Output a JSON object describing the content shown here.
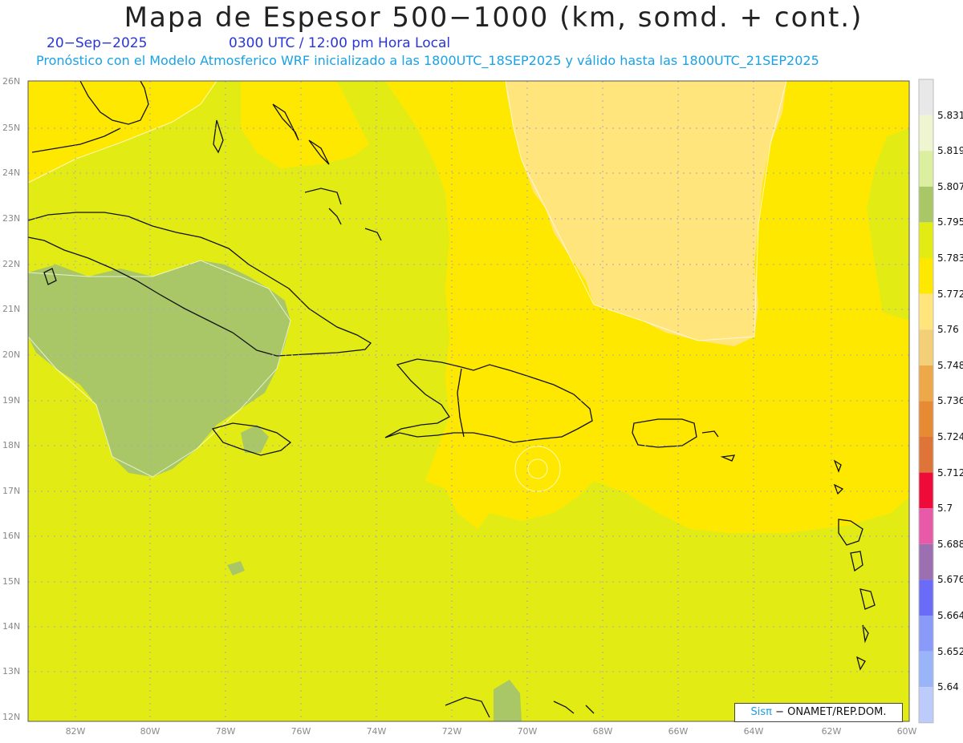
{
  "header": {
    "title": "Mapa de Espesor 500−1000 (km, somd. + cont.)",
    "date": "20−Sep−2025",
    "time": "0300 UTC / 12:00 pm Hora Local",
    "forecast": "Pronóstico con el Modelo Atmosferico WRF inicializado a las 1800UTC_18SEP2025 y válido hasta las  1800UTC_21SEP2025"
  },
  "map": {
    "lat_labels": [
      "26N",
      "25N",
      "24N",
      "23N",
      "22N",
      "21N",
      "20N",
      "19N",
      "18N",
      "17N",
      "16N",
      "15N",
      "14N",
      "13N",
      "12N"
    ],
    "lon_labels": [
      "82W",
      "80W",
      "78W",
      "76W",
      "74W",
      "72W",
      "70W",
      "68W",
      "66W",
      "64W",
      "62W",
      "60W"
    ],
    "colors": {
      "thickness_5783": "#e2ec14",
      "thickness_5795": "#a9c766",
      "thickness_5772": "#ffe800",
      "thickness_5760": "#ffe57c",
      "coast": "#111111",
      "grid": "#a6a6c8"
    }
  },
  "colorbar": {
    "labels": [
      "5.831",
      "5.819",
      "5.807",
      "5.795",
      "5.783",
      "5.772",
      "5.76",
      "5.748",
      "5.736",
      "5.724",
      "5.712",
      "5.7",
      "5.688",
      "5.676",
      "5.664",
      "5.652",
      "5.64"
    ],
    "colors": [
      "#e8e8e8",
      "#eef5d0",
      "#dceea0",
      "#a9c766",
      "#e2ec14",
      "#ffe800",
      "#ffe57c",
      "#f3cf78",
      "#eda84a",
      "#e68a34",
      "#de7438",
      "#ee0b3a",
      "#e85aa8",
      "#9b6fb0",
      "#6a6cf8",
      "#8a9af8",
      "#9ab4fa",
      "#bccbfa"
    ]
  },
  "credit": {
    "brand": "Sisπ",
    "org": "− ONAMET/REP.DOM."
  }
}
